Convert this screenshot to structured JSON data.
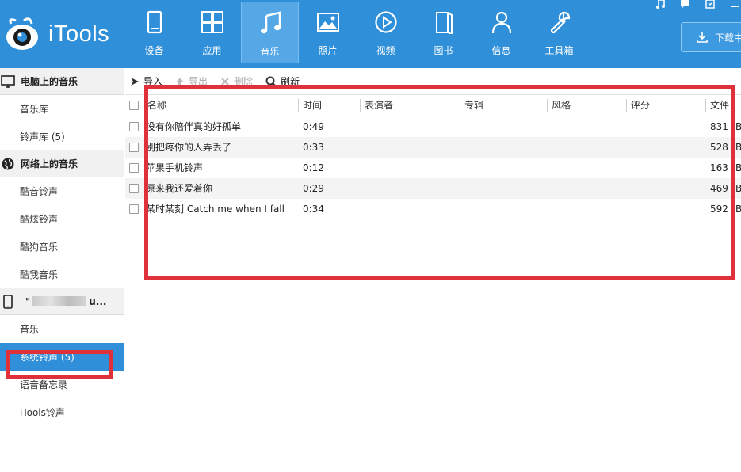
{
  "app": {
    "name": "iTools"
  },
  "nav": [
    {
      "label": "设备",
      "icon": "device-icon",
      "active": false
    },
    {
      "label": "应用",
      "icon": "apps-icon",
      "active": false
    },
    {
      "label": "音乐",
      "icon": "music-note-icon",
      "active": true
    },
    {
      "label": "照片",
      "icon": "photo-icon",
      "active": false
    },
    {
      "label": "视频",
      "icon": "video-play-icon",
      "active": false
    },
    {
      "label": "图书",
      "icon": "book-icon",
      "active": false
    },
    {
      "label": "信息",
      "icon": "person-icon",
      "active": false
    },
    {
      "label": "工具箱",
      "icon": "wrench-icon",
      "active": false
    }
  ],
  "header": {
    "download_label": "下载中"
  },
  "sidebar": {
    "sections": [
      {
        "title": "电脑上的音乐",
        "icon": "monitor-icon",
        "items": [
          {
            "label": "音乐库",
            "selected": false
          },
          {
            "label": "铃声库 (5)",
            "selected": false
          }
        ]
      },
      {
        "title": "网络上的音乐",
        "icon": "globe-icon",
        "items": [
          {
            "label": "酷音铃声",
            "selected": false
          },
          {
            "label": "酷炫铃声",
            "selected": false
          },
          {
            "label": "酷狗音乐",
            "selected": false
          },
          {
            "label": "酷我音乐",
            "selected": false
          }
        ]
      },
      {
        "title_prefix": "\"",
        "title_suffix": "u...",
        "icon": "phone-icon",
        "items": [
          {
            "label": "音乐",
            "selected": false
          },
          {
            "label": "系统铃声 (5)",
            "selected": true
          },
          {
            "label": "语音备忘录",
            "selected": false
          },
          {
            "label": "iTools铃声",
            "selected": false
          }
        ]
      }
    ]
  },
  "toolbar": {
    "import_label": "导入",
    "export_label": "导出",
    "delete_label": "删除",
    "refresh_label": "刷新"
  },
  "table": {
    "columns": [
      "名称",
      "时间",
      "表演者",
      "专辑",
      "风格",
      "评分",
      "文件"
    ],
    "rows": [
      {
        "name": "没有你陪伴真的好孤单",
        "time": "0:49",
        "size": "831"
      },
      {
        "name": "别把疼你的人弄丢了",
        "time": "0:33",
        "size": "528"
      },
      {
        "name": "苹果手机铃声",
        "time": "0:12",
        "size": "163"
      },
      {
        "name": "原来我还爱着你",
        "time": "0:29",
        "size": "469"
      },
      {
        "name": "某时某刻 Catch me when I fall",
        "time": "0:34",
        "size": "592"
      }
    ],
    "size_suffix": "B"
  },
  "colors": {
    "header": "#2f8fd9",
    "selected": "#2f8fd9",
    "annotation": "#e0303a"
  }
}
